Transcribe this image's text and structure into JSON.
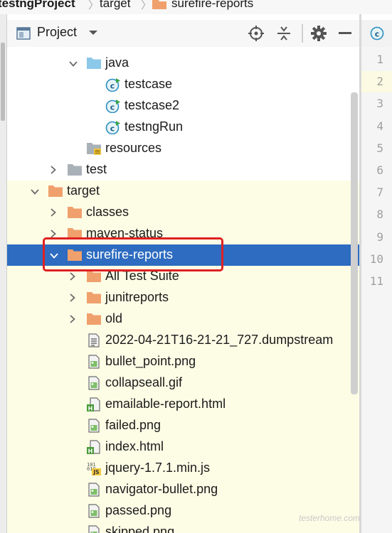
{
  "breadcrumb": {
    "project": "testngProject",
    "target": "target",
    "current": "surefire-reports"
  },
  "panel": {
    "title": "Project",
    "icons": [
      "crosshair-icon",
      "collapse-all-icon",
      "gear-icon",
      "minimize-icon"
    ]
  },
  "tree": [
    {
      "label": "java",
      "icon": "folder-blue-icon",
      "expanded": true,
      "depth": 3
    },
    {
      "label": "testcase",
      "icon": "java-class-icon",
      "depth": 4
    },
    {
      "label": "testcase2",
      "icon": "java-class-icon",
      "depth": 4
    },
    {
      "label": "testngRun",
      "icon": "java-class-icon",
      "depth": 4
    },
    {
      "label": "resources",
      "icon": "resources-folder-icon",
      "depth": 3
    },
    {
      "label": "test",
      "icon": "folder-gray-icon",
      "expanded": false,
      "depth": 2
    },
    {
      "label": "target",
      "icon": "folder-orange-icon",
      "expanded": true,
      "depth": 1
    },
    {
      "label": "classes",
      "icon": "folder-orange-icon",
      "expanded": false,
      "depth": 2
    },
    {
      "label": "maven-status",
      "icon": "folder-orange-icon",
      "expanded": false,
      "depth": 2
    },
    {
      "label": "surefire-reports",
      "icon": "folder-orange-icon",
      "expanded": true,
      "depth": 2,
      "selected": true
    },
    {
      "label": "All Test Suite",
      "icon": "folder-orange-icon",
      "expanded": false,
      "depth": 3
    },
    {
      "label": "junitreports",
      "icon": "folder-orange-icon",
      "expanded": false,
      "depth": 3
    },
    {
      "label": "old",
      "icon": "folder-orange-icon",
      "expanded": false,
      "depth": 3
    },
    {
      "label": "2022-04-21T16-21-21_727.dumpstream",
      "icon": "text-file-icon",
      "depth": 3
    },
    {
      "label": "bullet_point.png",
      "icon": "image-file-icon",
      "depth": 3
    },
    {
      "label": "collapseall.gif",
      "icon": "image-file-icon",
      "depth": 3
    },
    {
      "label": "emailable-report.html",
      "icon": "html-file-icon",
      "depth": 3
    },
    {
      "label": "failed.png",
      "icon": "image-file-icon",
      "depth": 3
    },
    {
      "label": "index.html",
      "icon": "html-file-icon",
      "depth": 3
    },
    {
      "label": "jquery-1.7.1.min.js",
      "icon": "js-file-icon",
      "depth": 3
    },
    {
      "label": "navigator-bullet.png",
      "icon": "image-file-icon",
      "depth": 3
    },
    {
      "label": "passed.png",
      "icon": "image-file-icon",
      "depth": 3
    },
    {
      "label": "skipped.png",
      "icon": "image-file-icon",
      "depth": 3
    }
  ],
  "line_numbers": [
    "1",
    "2",
    "3",
    "4",
    "5",
    "6",
    "7",
    "8",
    "9",
    "10",
    "11"
  ],
  "watermark": "testerhome.com",
  "colors": {
    "selection": "#2d6cc0",
    "annotation": "#e02020",
    "folder_orange": "#f0a06c",
    "folder_blue": "#8cc8e8",
    "folder_gray": "#a9b1b8"
  }
}
